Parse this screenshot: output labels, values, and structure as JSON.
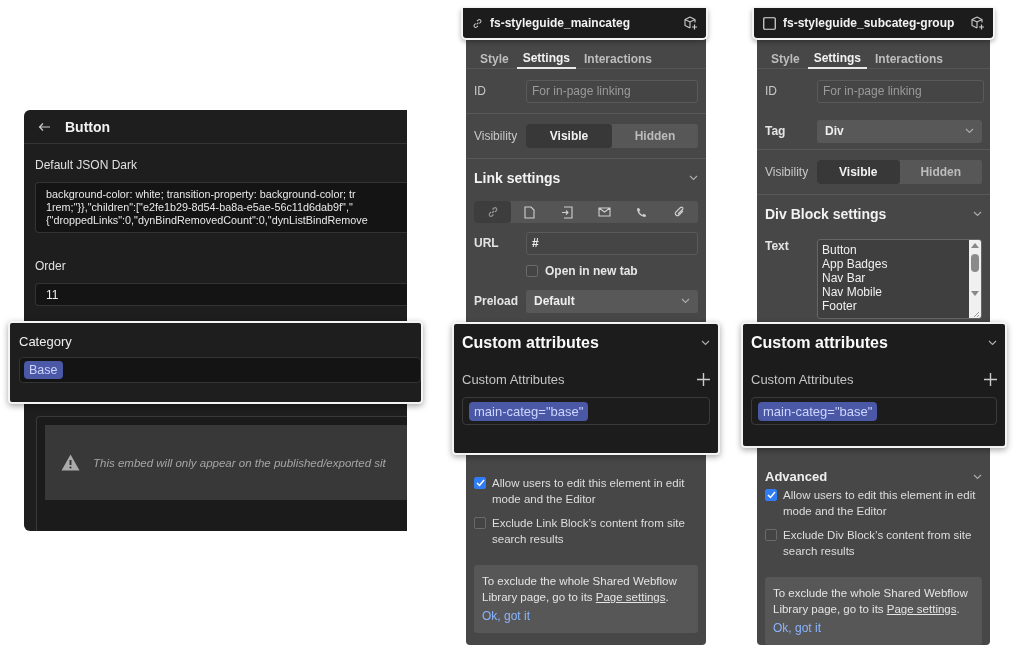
{
  "cms_item": {
    "title": "Button",
    "fields": [
      {
        "kind": "code",
        "label": "Default JSON Dark",
        "lines": [
          "background-color: white; transition-property: background-color; tr",
          "1rem;\"}},\"children\":[\"e2fe1b29-8d54-ba8a-e5ae-56c11d6dab9f\",\"",
          "{\"droppedLinks\":0,\"dynBindRemovedCount\":0,\"dynListBindRemove"
        ]
      },
      {
        "kind": "input",
        "label": "Order",
        "value": "11"
      }
    ],
    "category": {
      "label": "Category",
      "tags": [
        "Base"
      ]
    },
    "embed_notice": "This embed will only appear on the published/exported sit"
  },
  "panels": [
    {
      "element": {
        "kind": "link",
        "name": "fs-styleguide_maincateg"
      },
      "tabs": [
        {
          "label": "Style",
          "selected": false
        },
        {
          "label": "Settings",
          "selected": true
        },
        {
          "label": "Interactions",
          "selected": false
        }
      ],
      "rows": [
        {
          "kind": "text_field",
          "label": "ID",
          "placeholder": "For in-page linking"
        },
        {
          "kind": "segmented",
          "label": "Visibility",
          "options": [
            {
              "label": "Visible",
              "selected": true
            },
            {
              "label": "Hidden",
              "selected": false
            }
          ]
        },
        {
          "kind": "section",
          "title": "Link settings"
        },
        {
          "kind": "link_types",
          "items": [
            {
              "kind": "url",
              "selected": true
            },
            {
              "kind": "page",
              "selected": false
            },
            {
              "kind": "section",
              "selected": false
            },
            {
              "kind": "email",
              "selected": false
            },
            {
              "kind": "phone",
              "selected": false
            },
            {
              "kind": "file",
              "selected": false
            }
          ]
        },
        {
          "kind": "input",
          "label": "URL",
          "value": "#"
        },
        {
          "kind": "checkbox",
          "label": "Open in new tab",
          "checked": false
        },
        {
          "kind": "select",
          "label": "Preload",
          "value": "Default"
        }
      ],
      "custom_attributes": {
        "title": "Custom attributes",
        "label": "Custom Attributes",
        "attributes": [
          "main-categ=\"base\""
        ]
      },
      "checkboxes": [
        {
          "label": "Allow users to edit this element in edit mode and the Editor",
          "checked": true
        },
        {
          "label": "Exclude Link Block’s content from site search results",
          "checked": false
        }
      ],
      "notice": {
        "text_before": "To exclude the whole Shared Webflow Library page, go to its ",
        "link": "Page settings",
        "text_after": ".",
        "action": "Ok, got it"
      }
    },
    {
      "element": {
        "kind": "div",
        "name": "fs-styleguide_subcateg-group"
      },
      "tabs": [
        {
          "label": "Style",
          "selected": false
        },
        {
          "label": "Settings",
          "selected": true
        },
        {
          "label": "Interactions",
          "selected": false
        }
      ],
      "rows": [
        {
          "kind": "text_field",
          "label": "ID",
          "placeholder": "For in-page linking"
        },
        {
          "kind": "select",
          "label": "Tag",
          "value": "Div"
        },
        {
          "kind": "segmented",
          "label": "Visibility",
          "options": [
            {
              "label": "Visible",
              "selected": true
            },
            {
              "label": "Hidden",
              "selected": false
            }
          ]
        },
        {
          "kind": "section",
          "title": "Div Block settings"
        },
        {
          "kind": "text_list",
          "label": "Text",
          "lines": [
            "Button",
            "App Badges",
            "Nav Bar",
            "Nav Mobile",
            "Footer"
          ]
        }
      ],
      "custom_attributes": {
        "title": "Custom attributes",
        "label": "Custom Attributes",
        "attributes": [
          "main-categ=\"base\""
        ]
      },
      "advanced_title": "Advanced",
      "checkboxes": [
        {
          "label": "Allow users to edit this element in edit mode and the Editor",
          "checked": true
        },
        {
          "label": "Exclude Div Block’s content from site search results",
          "checked": false
        }
      ],
      "notice": {
        "text_before": "To exclude the whole Shared Webflow Library page, go to its ",
        "link": "Page settings",
        "text_after": ".",
        "action": "Ok, got it"
      }
    }
  ]
}
